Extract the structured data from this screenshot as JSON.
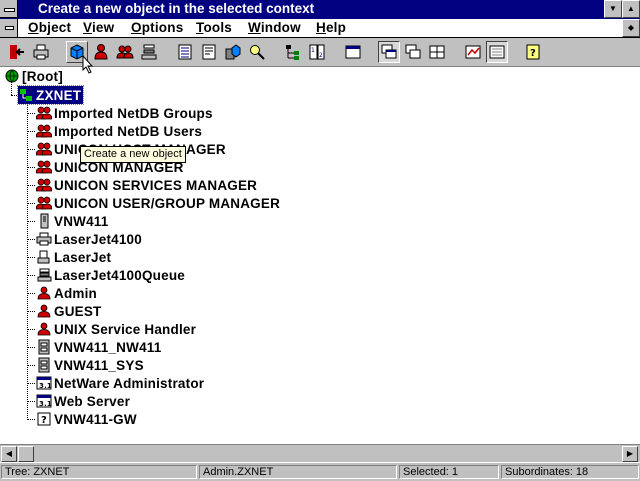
{
  "title_bar": {
    "title": "Create a new object in the selected context"
  },
  "menu": [
    {
      "pre": "",
      "ul": "O",
      "post": "bject"
    },
    {
      "pre": "",
      "ul": "V",
      "post": "iew"
    },
    {
      "pre": "",
      "ul": "O",
      "post": "ptions"
    },
    {
      "pre": "",
      "ul": "T",
      "post": "ools"
    },
    {
      "pre": "",
      "ul": "W",
      "post": "indow"
    },
    {
      "pre": "",
      "ul": "H",
      "post": "elp"
    }
  ],
  "toolbar": {
    "buttons": [
      "exit-icon",
      "print-icon",
      "create-object-icon",
      "user-icon",
      "group-icon",
      "queue-icon",
      "details-icon",
      "rights-icon",
      "trustees-icon",
      "search-icon",
      "tree-icon",
      "sort-icon",
      "browser-icon",
      "cascade-icon",
      "tile-horizontal-icon",
      "tile-vertical-icon",
      "chart-icon",
      "partition-icon",
      "help-icon"
    ]
  },
  "tooltip": {
    "text": "Create a new object"
  },
  "tree": {
    "root": {
      "label": "[Root]",
      "icon": "globe-icon"
    },
    "container": {
      "label": "ZXNET",
      "icon": "organization-icon"
    },
    "items": [
      {
        "label": "Imported NetDB Groups",
        "icon": "group-icon"
      },
      {
        "label": "Imported NetDB Users",
        "icon": "group-icon"
      },
      {
        "label": "UNICON HOST MANAGER",
        "icon": "group-icon"
      },
      {
        "label": "UNICON MANAGER",
        "icon": "group-icon"
      },
      {
        "label": "UNICON SERVICES MANAGER",
        "icon": "group-icon"
      },
      {
        "label": "UNICON USER/GROUP MANAGER",
        "icon": "group-icon"
      },
      {
        "label": "VNW411",
        "icon": "server-icon"
      },
      {
        "label": "LaserJet4100",
        "icon": "printer-icon"
      },
      {
        "label": "LaserJet",
        "icon": "print-server-icon"
      },
      {
        "label": "LaserJet4100Queue",
        "icon": "print-queue-icon"
      },
      {
        "label": "Admin",
        "icon": "user-icon"
      },
      {
        "label": "GUEST",
        "icon": "user-icon"
      },
      {
        "label": "UNIX Service Handler",
        "icon": "user-icon"
      },
      {
        "label": "VNW411_NW411",
        "icon": "volume-icon"
      },
      {
        "label": "VNW411_SYS",
        "icon": "volume-icon"
      },
      {
        "label": "NetWare Administrator",
        "icon": "application-icon"
      },
      {
        "label": "Web Server",
        "icon": "application-icon"
      },
      {
        "label": "VNW411-GW",
        "icon": "unknown-object-icon"
      }
    ]
  },
  "status_bar": {
    "tree": "Tree: ZXNET",
    "context": "Admin.ZXNET",
    "selected": "Selected: 1",
    "subordinates": "Subordinates: 18"
  },
  "colors": {
    "titlebar": "#000080",
    "face": "#c0c0c0",
    "selection": "#000080",
    "tooltip_bg": "#ffffe1",
    "user_red": "#cc0000"
  }
}
